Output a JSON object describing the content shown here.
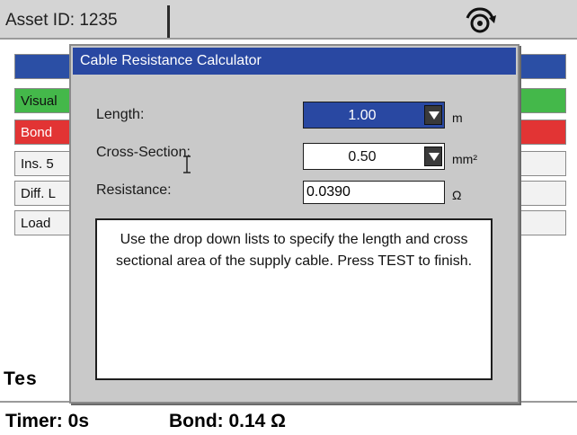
{
  "header": {
    "asset_id": "Asset ID: 1235",
    "icon": "rotate-icon"
  },
  "background": {
    "rows": [
      "",
      "Visual",
      "Bond",
      "Ins. 5",
      "Diff. L",
      "Load"
    ],
    "test_heading": "Tes",
    "timer": "Timer: 0s",
    "bond": "Bond: 0.14 Ω"
  },
  "dialog": {
    "title": "Cable Resistance Calculator",
    "length": {
      "label": "Length:",
      "value": "1.00",
      "unit": "m"
    },
    "cross_section": {
      "label": "Cross-Section:",
      "value": "0.50",
      "unit": "mm²"
    },
    "resistance": {
      "label": "Resistance:",
      "value": "0.0390",
      "unit": "Ω"
    },
    "message": "Use the drop down lists to specify the length and cross sectional area of the supply cable.  Press TEST to finish."
  },
  "colors": {
    "title_bar": "#2948a2",
    "row_green": "#44b84a",
    "row_red": "#e23434",
    "active_field": "#2948a2"
  }
}
